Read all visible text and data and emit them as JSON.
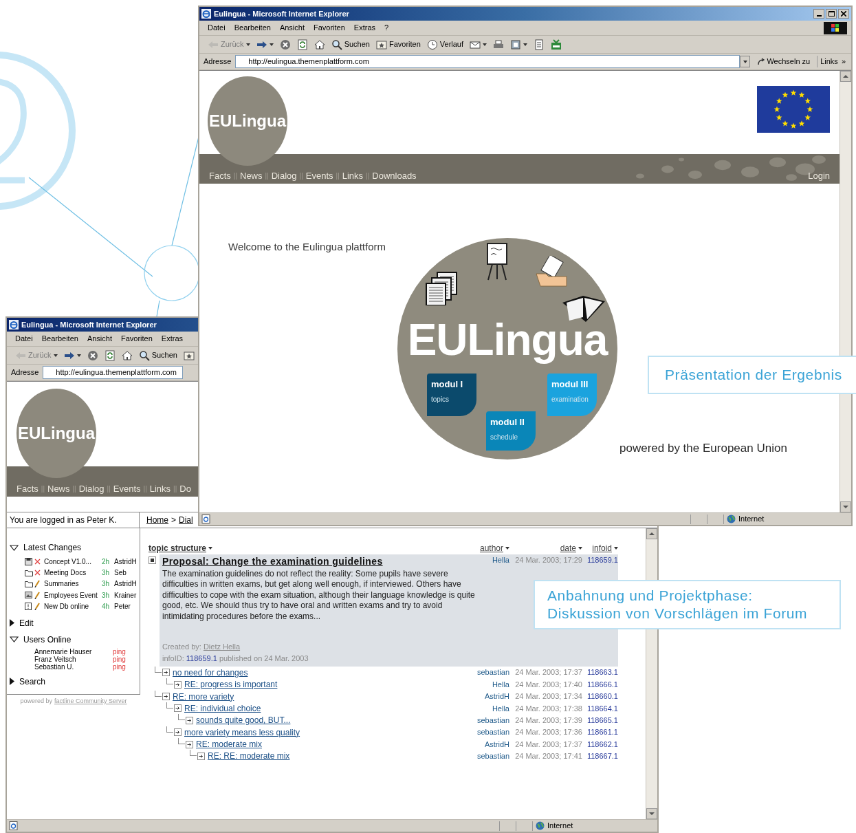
{
  "front_window": {
    "title": "Eulingua - Microsoft Internet Explorer",
    "menu": [
      "Datei",
      "Bearbeiten",
      "Ansicht",
      "Favoriten",
      "Extras",
      "?"
    ],
    "toolbar": [
      {
        "kind": "back",
        "label": "Zurück",
        "disabled": true
      },
      {
        "kind": "forward",
        "disabled": false
      },
      {
        "kind": "stop",
        "disabled": false
      },
      {
        "kind": "refresh",
        "disabled": false
      },
      {
        "kind": "home",
        "disabled": false
      },
      {
        "kind": "search",
        "label": "Suchen",
        "disabled": false
      },
      {
        "kind": "favorites",
        "label": "Favoriten",
        "disabled": false
      },
      {
        "kind": "history",
        "label": "Verlauf",
        "disabled": false
      },
      {
        "kind": "mail",
        "disabled": false
      },
      {
        "kind": "print",
        "disabled": false
      },
      {
        "kind": "edit",
        "disabled": false
      },
      {
        "kind": "notes",
        "disabled": false
      },
      {
        "kind": "messenger",
        "disabled": false
      }
    ],
    "address": {
      "label": "Adresse",
      "value": "http://eulingua.themenplattform.com"
    },
    "go_button": "Wechseln zu",
    "links": "Links",
    "links_more": "»",
    "page": {
      "logo": "EULingua",
      "nav": [
        "Facts",
        "News",
        "Dialog",
        "Events",
        "Links",
        "Downloads"
      ],
      "nav_separator": "||",
      "login": "Login",
      "welcome": "Welcome to the Eulingua plattform",
      "emblem_title": "EULingua",
      "modules": [
        {
          "title": "modul I",
          "subtitle": "topics",
          "color": "#0b4a6c"
        },
        {
          "title": "modul II",
          "subtitle": "schedule",
          "color": "#0a86b8"
        },
        {
          "title": "modul III",
          "subtitle": "examination",
          "color": "#1aa3de"
        }
      ],
      "powered": "powered by the European Union"
    },
    "status": "Internet"
  },
  "back_window": {
    "title": "Eulingua - Microsoft Internet Explorer",
    "menu": [
      "Datei",
      "Bearbeiten",
      "Ansicht",
      "Favoriten",
      "Extras"
    ],
    "toolbar": [
      {
        "kind": "back",
        "label": "Zurück",
        "disabled": true
      },
      {
        "kind": "forward",
        "disabled": false
      },
      {
        "kind": "stop",
        "disabled": false
      },
      {
        "kind": "refresh",
        "disabled": false
      },
      {
        "kind": "home",
        "disabled": false
      },
      {
        "kind": "search",
        "label": "Suchen",
        "disabled": false
      },
      {
        "kind": "favorites",
        "disabled": false
      }
    ],
    "address": {
      "label": "Adresse",
      "value": "http://eulingua.themenplattform.com"
    },
    "page": {
      "logo": "EULingua",
      "nav": [
        "Facts",
        "News",
        "Dialog",
        "Events",
        "Links",
        "Do"
      ],
      "nav_separator": "||",
      "login_text": "You are logged in as Peter K.",
      "breadcrumb": {
        "items": [
          "Home",
          "Dial"
        ],
        "separator": ">"
      },
      "sidebar": {
        "sections": [
          {
            "title": "Latest Changes",
            "expanded": true,
            "changes": [
              {
                "kind": "document",
                "deleted": true,
                "name": "Concept V1.0...",
                "age": "2h",
                "user": "AstridH"
              },
              {
                "kind": "folder",
                "deleted": true,
                "name": "Meeting Docs",
                "age": "3h",
                "user": "Seb"
              },
              {
                "kind": "folder",
                "deleted": false,
                "name": "Summaries",
                "age": "3h",
                "user": "AstridH"
              },
              {
                "kind": "image",
                "deleted": false,
                "name": "Employees Event",
                "age": "3h",
                "user": "Krainer"
              },
              {
                "kind": "note",
                "deleted": false,
                "name": "New Db online",
                "age": "4h",
                "user": "Peter"
              }
            ]
          },
          {
            "title": "Edit",
            "expanded": false
          },
          {
            "title": "Users Online",
            "expanded": true,
            "users": [
              {
                "name": "Annemarie Hauser",
                "status": "ping"
              },
              {
                "name": "Franz Veitsch",
                "status": "ping"
              },
              {
                "name": "Sebastian U.",
                "status": "ping"
              }
            ]
          },
          {
            "title": "Search",
            "expanded": false
          }
        ],
        "footer": {
          "text": "powered by",
          "link": "factline Community Server"
        }
      },
      "forum": {
        "columns": [
          "topic structure",
          "author",
          "date",
          "infoid"
        ],
        "post": {
          "title": "Proposal: Change the examination guidelines",
          "expanded": true,
          "body": "The examination guidelines do not reflect the reality: Some pupils have severe difficulties in written exams, but get along well enough, if interviewed. Others have difficulties to cope with the exam situation, although their language knowledge is quite good, etc. We should thus try to have oral and written exams and try to avoid intimidating procedures before the exams...",
          "created_label": "Created by:",
          "creator": "Dietz Hella",
          "id_label": "infoID:",
          "id": "118659.1",
          "published": "published on 24 Mar. 2003",
          "author": "Hella",
          "date": "24 Mar. 2003; 17:29",
          "infoid": "118659.1",
          "replies": [
            {
              "title": "no need for changes",
              "author": "sebastian",
              "date": "24 Mar. 2003; 17:37",
              "infoid": "118663.1",
              "expanded": false,
              "children": [
                {
                  "title": "RE: progress is important",
                  "author": "Hella",
                  "date": "24 Mar. 2003; 17:40",
                  "infoid": "118666.1",
                  "expanded": false
                }
              ]
            },
            {
              "title": "RE: more variety",
              "author": "AstridH",
              "date": "24 Mar. 2003; 17:34",
              "infoid": "118660.1",
              "expanded": false,
              "children": [
                {
                  "title": "RE: individual choice",
                  "author": "Hella",
                  "date": "24 Mar. 2003; 17:38",
                  "infoid": "118664.1",
                  "expanded": false,
                  "children": [
                    {
                      "title": "sounds quite good, BUT...",
                      "author": "sebastian",
                      "date": "24 Mar. 2003; 17:39",
                      "infoid": "118665.1",
                      "expanded": false
                    }
                  ]
                },
                {
                  "title": "more variety means less quality",
                  "author": "sebastian",
                  "date": "24 Mar. 2003; 17:36",
                  "infoid": "118661.1",
                  "expanded": false,
                  "children": [
                    {
                      "title": "RE: moderate mix",
                      "author": "AstridH",
                      "date": "24 Mar. 2003; 17:37",
                      "infoid": "118662.1",
                      "expanded": false,
                      "children": [
                        {
                          "title": "RE: RE: moderate mix",
                          "author": "sebastian",
                          "date": "24 Mar. 2003; 17:41",
                          "infoid": "118667.1",
                          "expanded": false
                        }
                      ]
                    }
                  ]
                }
              ]
            }
          ]
        }
      }
    },
    "status": "Internet"
  },
  "callouts": [
    {
      "lines": [
        "Präsentation der Ergebnis"
      ]
    },
    {
      "lines": [
        "Anbahnung und Projektphase:",
        "Diskussion von Vorschlägen im Forum"
      ]
    }
  ]
}
